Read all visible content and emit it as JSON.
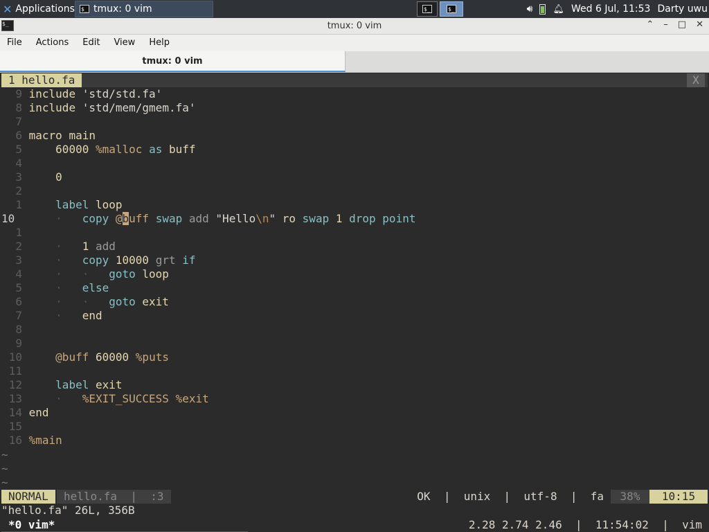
{
  "panel": {
    "apps_label": "Applications",
    "task_title": "tmux: 0 vim",
    "clock": "Wed  6 Jul, 11:53",
    "user": "Darty uwu"
  },
  "window": {
    "title": "tmux: 0 vim",
    "menu": [
      "File",
      "Actions",
      "Edit",
      "View",
      "Help"
    ],
    "tab_title": "tmux: 0 vim"
  },
  "vim": {
    "buffer_tab": "1 hello.fa",
    "close_label": "X",
    "lines": [
      {
        "n": "9",
        "text": "include 'std/std.fa'"
      },
      {
        "n": "8",
        "text": "include 'std/mem/gmem.fa'"
      },
      {
        "n": "7",
        "text": ""
      },
      {
        "n": "6",
        "text": "macro main"
      },
      {
        "n": "5",
        "text": "    60000 %malloc as buff"
      },
      {
        "n": "4",
        "text": ""
      },
      {
        "n": "3",
        "text": "    0"
      },
      {
        "n": "2",
        "text": ""
      },
      {
        "n": "1",
        "text": "    label loop"
      },
      {
        "n": "10",
        "text": "        copy @buff swap add \"Hello\\n\" ro swap 1 drop point",
        "current": true
      },
      {
        "n": "1",
        "text": ""
      },
      {
        "n": "2",
        "text": "        1 add"
      },
      {
        "n": "3",
        "text": "        copy 10000 grt if"
      },
      {
        "n": "4",
        "text": "            goto loop"
      },
      {
        "n": "5",
        "text": "        else"
      },
      {
        "n": "6",
        "text": "            goto exit"
      },
      {
        "n": "7",
        "text": "        end"
      },
      {
        "n": "8",
        "text": ""
      },
      {
        "n": "9",
        "text": ""
      },
      {
        "n": "10",
        "text": "    @buff 60000 %puts"
      },
      {
        "n": "11",
        "text": ""
      },
      {
        "n": "12",
        "text": "    label exit"
      },
      {
        "n": "13",
        "text": "        %EXIT_SUCCESS %exit"
      },
      {
        "n": "14",
        "text": "end"
      },
      {
        "n": "15",
        "text": ""
      },
      {
        "n": "16",
        "text": "%main"
      }
    ],
    "tilde": "~",
    "status": {
      "mode": "NORMAL",
      "file": "hello.fa  |  :3",
      "right": "OK  |  unix  |  utf-8  |  fa",
      "percent": "38%",
      "position": "10:15"
    },
    "message": "\"hello.fa\" 26L, 356B"
  },
  "tmux": {
    "window_label": "*0 vim*",
    "right": "2.28 2.74 2.46  |  11:54:02  |  vim"
  },
  "colors": {
    "background": "#2b2b2b",
    "accent_yellow": "#d8d39e",
    "keyword_cyan": "#88c0c5",
    "operator_orange": "#c8a77c"
  }
}
